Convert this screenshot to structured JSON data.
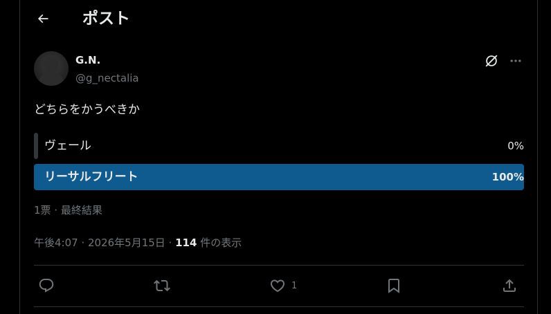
{
  "header": {
    "title": "ポスト",
    "back_icon": "arrow-left-icon"
  },
  "author": {
    "display_name": "G.N.",
    "handle": "@g_nectalia"
  },
  "tweet": {
    "text": "どちらをかうべきか"
  },
  "poll": {
    "options": [
      {
        "label": "ヴェール",
        "percent_text": "0%",
        "percent": 0
      },
      {
        "label": "リーサルフリート",
        "percent_text": "100%",
        "percent": 100
      }
    ],
    "meta": "1票 · 最終結果"
  },
  "timestamp": {
    "time": "午後4:07 · 2026年5月15日 · ",
    "views": "114",
    "views_label": " 件の表示"
  },
  "actions": {
    "like_count": "1"
  },
  "colors": {
    "background": "#000000",
    "text": "#e7e9ea",
    "secondary": "#71767b",
    "poll_winner": "#0f5a8f",
    "poll_loser": "#333639",
    "border": "#2f3336"
  }
}
